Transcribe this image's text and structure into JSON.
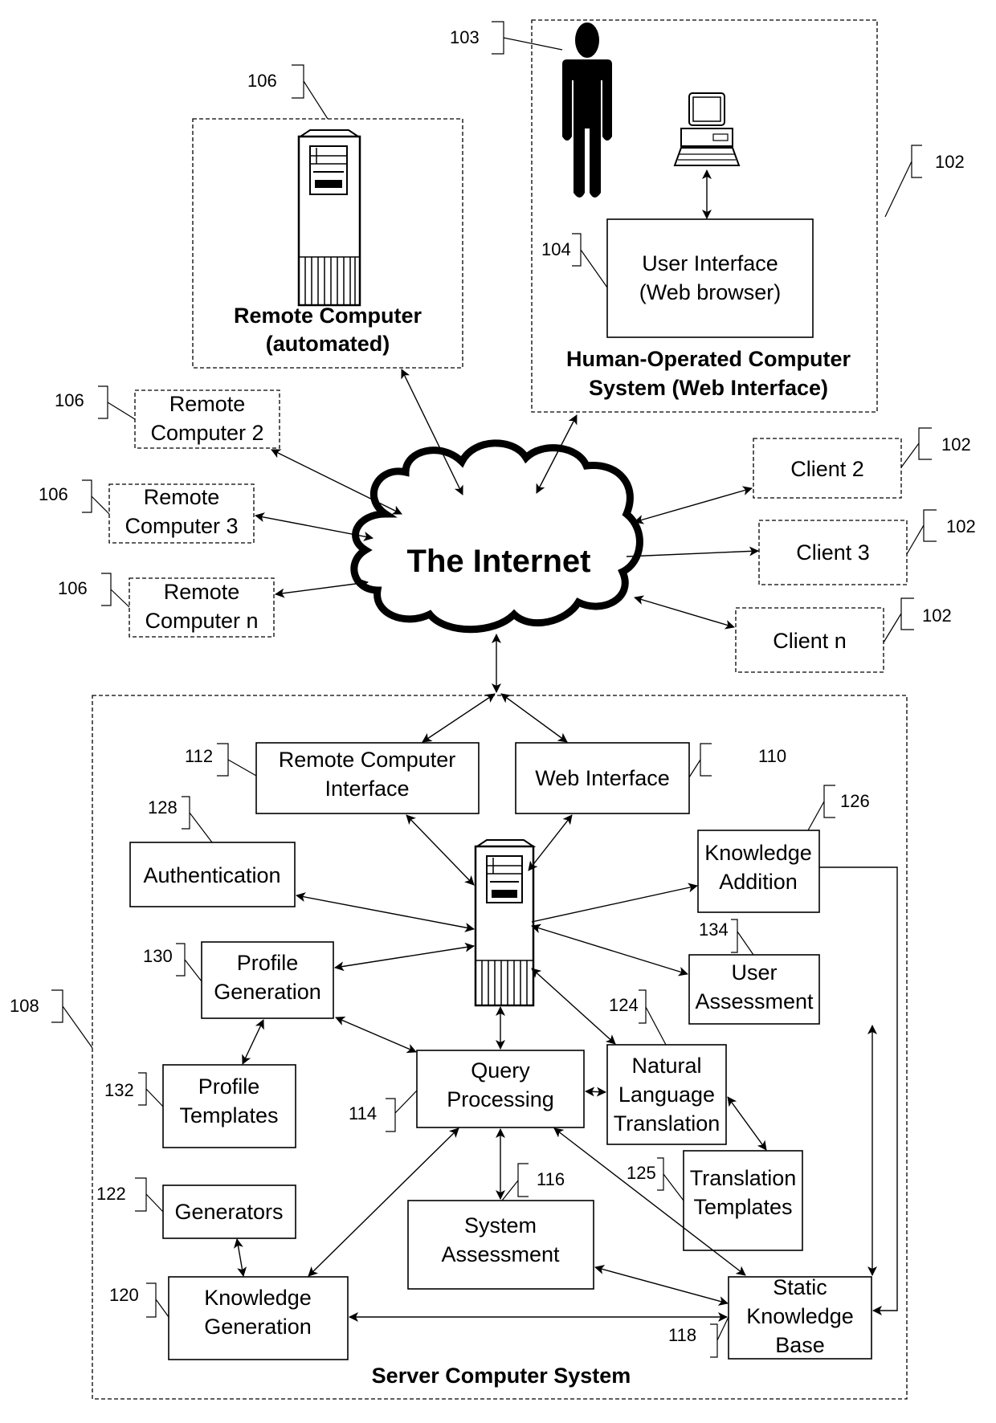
{
  "figure": {
    "internet": "The Internet",
    "server_system": {
      "title": "Server Computer System",
      "ref": "108"
    },
    "remote_main": {
      "title_line1": "Remote Computer",
      "title_line2": "(automated)",
      "ref": "106"
    },
    "human_system": {
      "title_line1": "Human-Operated Computer",
      "title_line2": "System (Web Interface)",
      "ref": "102",
      "person_ref": "103",
      "ui_ref": "104",
      "ui_line1": "User Interface",
      "ui_line2": "(Web browser)"
    },
    "remote_others": [
      {
        "line1": "Remote",
        "line2": "Computer 2",
        "ref": "106"
      },
      {
        "line1": "Remote",
        "line2": "Computer 3",
        "ref": "106"
      },
      {
        "line1": "Remote",
        "line2": "Computer n",
        "ref": "106"
      }
    ],
    "clients": [
      {
        "label": "Client 2",
        "ref": "102"
      },
      {
        "label": "Client 3",
        "ref": "102"
      },
      {
        "label": "Client n",
        "ref": "102"
      }
    ],
    "modules": {
      "remote_interface": {
        "line1": "Remote Computer",
        "line2": "Interface",
        "ref": "112"
      },
      "web_interface": {
        "line1": "Web Interface",
        "ref": "110"
      },
      "authentication": {
        "line1": "Authentication",
        "ref": "128"
      },
      "knowledge_addition": {
        "line1": "Knowledge",
        "line2": "Addition",
        "ref": "126"
      },
      "profile_generation": {
        "line1": "Profile",
        "line2": "Generation",
        "ref": "130"
      },
      "user_assessment": {
        "line1": "User",
        "line2": "Assessment",
        "ref": "134"
      },
      "profile_templates": {
        "line1": "Profile",
        "line2": "Templates",
        "ref": "132"
      },
      "query_processing": {
        "line1": "Query",
        "line2": "Processing",
        "ref": "114"
      },
      "nl_translation": {
        "line1": "Natural",
        "line2": "Language",
        "line3": "Translation",
        "ref": "124"
      },
      "translation_templates": {
        "line1": "Translation",
        "line2": "Templates",
        "ref": "125"
      },
      "generators": {
        "line1": "Generators",
        "ref": "122"
      },
      "system_assessment": {
        "line1": "System",
        "line2": "Assessment",
        "ref": "116"
      },
      "knowledge_generation": {
        "line1": "Knowledge",
        "line2": "Generation",
        "ref": "120"
      },
      "static_kb": {
        "line1": "Static",
        "line2": "Knowledge",
        "line3": "Base",
        "ref": "118"
      }
    }
  }
}
